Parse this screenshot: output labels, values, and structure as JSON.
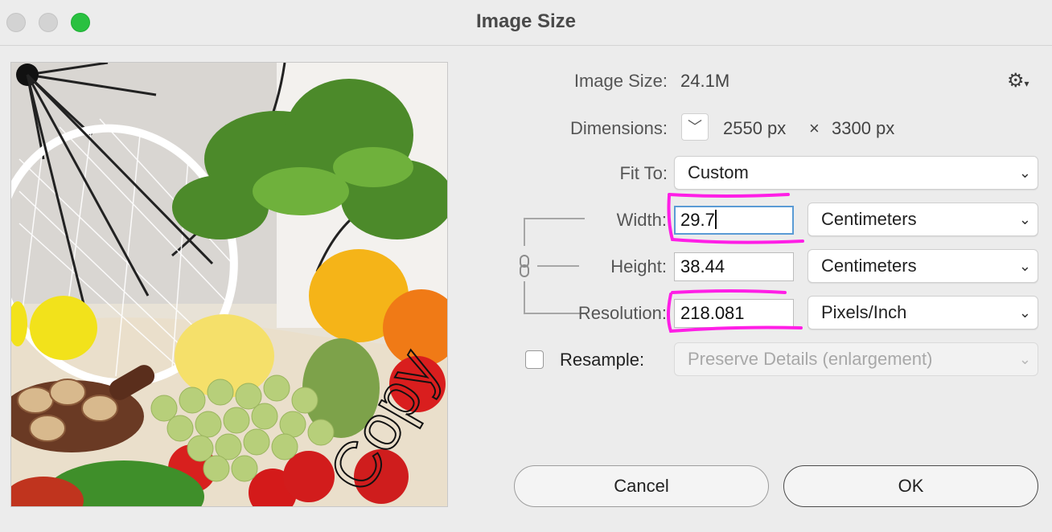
{
  "window": {
    "title": "Image Size"
  },
  "info": {
    "image_size_label": "Image Size:",
    "image_size_value": "24.1M",
    "dimensions_label": "Dimensions:",
    "dimensions_width": "2550 px",
    "dimensions_times": "×",
    "dimensions_height": "3300 px"
  },
  "fit_to": {
    "label": "Fit To:",
    "value": "Custom"
  },
  "width": {
    "label": "Width:",
    "value": "29.7",
    "unit": "Centimeters"
  },
  "height": {
    "label": "Height:",
    "value": "38.44",
    "unit": "Centimeters"
  },
  "resolution": {
    "label": "Resolution:",
    "value": "218.081",
    "unit": "Pixels/Inch"
  },
  "resample": {
    "label": "Resample:",
    "checked": false,
    "method": "Preserve Details (enlargement)"
  },
  "preview": {
    "watermark_text": "Copy"
  },
  "buttons": {
    "cancel": "Cancel",
    "ok": "OK"
  },
  "icons": {
    "settings": "gear-icon",
    "dimensions_menu": "chevron-down-icon",
    "constrain": "chain-link-icon"
  },
  "colors": {
    "annotation": "#ff1ee6",
    "focus": "#5a9bd5",
    "maximize": "#29c140"
  }
}
